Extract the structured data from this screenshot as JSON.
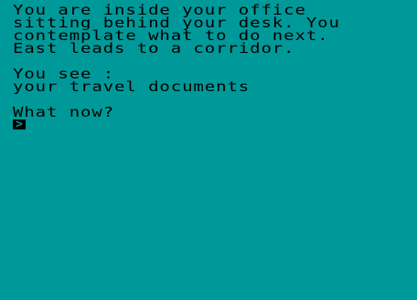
{
  "screen": {
    "background_color": "#009999",
    "text_color": "#000000"
  },
  "description": {
    "line1": "You are inside your office",
    "line2": "sitting behind your desk. You",
    "line3": "contemplate what to do next.",
    "line4": "East leads to a corridor."
  },
  "items": {
    "heading": "You see :",
    "list": [
      "your travel documents"
    ]
  },
  "prompt": {
    "question": "What now?",
    "cursor_glyph": ">"
  }
}
